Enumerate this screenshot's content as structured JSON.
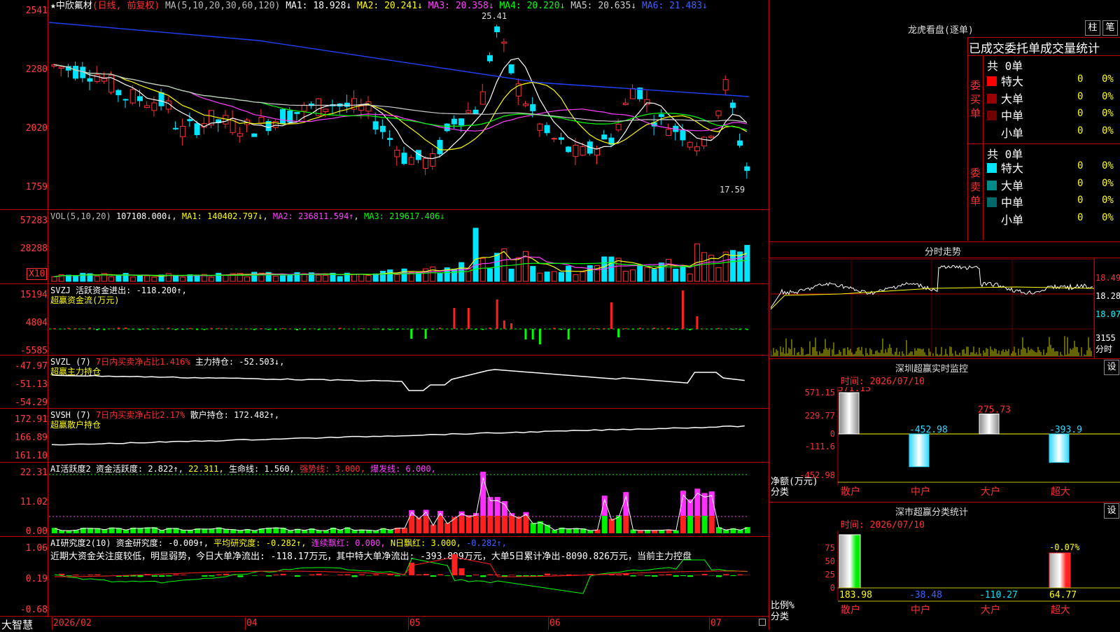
{
  "main": {
    "stock_name": "中欣氟材",
    "period": "(日线, 前复权)",
    "ma_prefix": "MA(5,10,20,30,60,120)",
    "ma": [
      {
        "label": "MA1: 18.928↓",
        "color": "#ffffff"
      },
      {
        "label": "MA2: 20.241↓",
        "color": "#ffff00"
      },
      {
        "label": "MA3: 20.358↓",
        "color": "#ff40ff"
      },
      {
        "label": "MA4: 20.220↓",
        "color": "#00ff00"
      },
      {
        "label": "MA5: 20.635↓",
        "color": "#cccccc"
      },
      {
        "label": "MA6: 21.483↓",
        "color": "#4060ff"
      }
    ],
    "y_ticks": [
      "2541",
      "2280",
      "2020",
      "1759"
    ],
    "high_label": "25.41",
    "low_label": "17.59"
  },
  "vol": {
    "title": "VOL(5,10,20)",
    "value": "107108.000↓",
    "ma1": "MA1: 140402.797↓",
    "ma2": "MA2: 236811.594↑",
    "ma3": "MA3: 219617.406↓",
    "y_ticks": [
      "57283",
      "28288"
    ],
    "unit": "X10"
  },
  "svzj": {
    "line1": "SVZJ  活跃资金进出: -118.200↑,",
    "line2": "超赢资金流(万元)",
    "y_ticks": [
      "15194",
      "4804",
      "-5585"
    ]
  },
  "svzl": {
    "prefix": "SVZL (7)",
    "ratio": "7日内买卖净占比1.416%",
    "hold": "主力持仓: -52.503↓,",
    "line2": "超赢主力持仓",
    "y_ticks": [
      "-47.97",
      "-51.13",
      "-54.29"
    ]
  },
  "svsh": {
    "prefix": "SVSH (7)",
    "ratio": "7日内买卖净占比2.17%",
    "hold": "散户持仓: 172.482↑,",
    "line2": "超赢散户持仓",
    "y_ticks": [
      "172.91",
      "166.89",
      "161.10"
    ]
  },
  "ai1": {
    "a": "AI活跃度2 资金活跃度: 2.822↑,",
    "b": "22.311,",
    "c": "生命线: 1.560,",
    "d": "强势线: 3.000,",
    "e": "爆发线: 6.000,",
    "y_ticks": [
      "22.31",
      "11.02",
      "0.00"
    ]
  },
  "ai2": {
    "a": "AI研究度2(10) 资金研究度: -0.009↑,",
    "b": "平均研究度: -0.282↑,",
    "c": "连续飘红: 0.000,",
    "d": "N日飘红: 3.000,",
    "e": "-0.282↑,",
    "comment": "近期大资金关注度较低，明显弱势，今日大单净流出: -118.17万元，其中特大单净流出: -393.899万元，大单5日累计净出-8090.826万元，当前主力控盘",
    "y_ticks": [
      "1.06",
      "0.19",
      "-0.68"
    ]
  },
  "xaxis": {
    "brand": "大智慧",
    "labels": [
      "2026/02",
      "04",
      "05",
      "06",
      "07"
    ]
  },
  "longhu": {
    "title": "龙虎看盘(逐单)",
    "btn1": "柱",
    "btn2": "笔",
    "subtitle": "已成交委托单成交量统计",
    "buy_total": "共 0单",
    "sell_total": "共 0单",
    "buy_label": "委买单",
    "sell_label": "委卖单",
    "buy_rows": [
      {
        "name": "特大",
        "count": "0",
        "pct": "0%",
        "color": "#ff0000"
      },
      {
        "name": "大单",
        "count": "0",
        "pct": "0%",
        "color": "#9a0000"
      },
      {
        "name": "中单",
        "count": "0",
        "pct": "0%",
        "color": "#700000"
      },
      {
        "name": "小单",
        "count": "0",
        "pct": "0%",
        "color": ""
      }
    ],
    "sell_rows": [
      {
        "name": "特大",
        "count": "0",
        "pct": "0%",
        "color": "#00e5ff"
      },
      {
        "name": "大单",
        "count": "0",
        "pct": "0%",
        "color": "#008a8a"
      },
      {
        "name": "中单",
        "count": "0",
        "pct": "0%",
        "color": "#006a6a"
      },
      {
        "name": "小单",
        "count": "0",
        "pct": "0%",
        "color": ""
      }
    ]
  },
  "fenshi": {
    "title": "分时走势",
    "y_right": [
      "18.49",
      "18.28",
      "18.07"
    ],
    "vol_right": "3155",
    "vol_unit": "分时"
  },
  "sz_monitor": {
    "title": "深圳超赢实时监控",
    "set": "设",
    "time": "时间: 2026/07/10",
    "y_ticks": [
      "571.15",
      "229.77",
      "0",
      "-111.6",
      "-452.98"
    ],
    "ylabel": "净额(万元)",
    "xlabel": "分类",
    "categories": [
      "散户",
      "中户",
      "大户",
      "超大"
    ],
    "values": [
      571.15,
      -452.98,
      275.73,
      -393.9
    ],
    "value_labels": [
      "571.15",
      "-452.98",
      "275.73",
      "-393.9"
    ]
  },
  "sz_class": {
    "title": "深市超赢分类统计",
    "set": "设",
    "time": "时间: 2026/07/10",
    "y_ticks": [
      "75",
      "50",
      "25",
      "0"
    ],
    "ylabel": "比例%",
    "xlabel": "分类",
    "categories": [
      "散户",
      "中户",
      "大户",
      "超大"
    ],
    "bottom_values": [
      "183.98",
      "-38.48",
      "-110.27",
      "64.77"
    ],
    "top_label": "-0.07%"
  }
}
